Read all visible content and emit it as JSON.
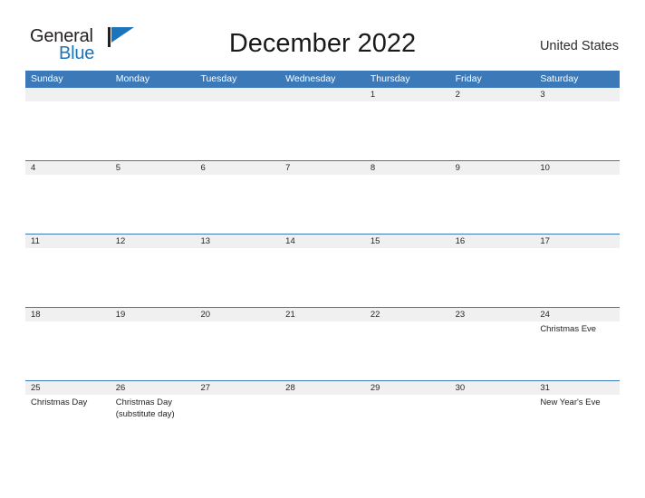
{
  "brand": {
    "name_part1": "General",
    "name_part2": "Blue",
    "flag_color": "#1b75bb"
  },
  "header": {
    "title": "December 2022",
    "region": "United States"
  },
  "calendar": {
    "accent_color": "#3b79b8",
    "date_band_color": "#f0f0f0",
    "weekday_headers": [
      "Sunday",
      "Monday",
      "Tuesday",
      "Wednesday",
      "Thursday",
      "Friday",
      "Saturday"
    ],
    "weeks": [
      {
        "dates": [
          "",
          "",
          "",
          "",
          "1",
          "2",
          "3"
        ],
        "events": [
          "",
          "",
          "",
          "",
          "",
          "",
          ""
        ]
      },
      {
        "dates": [
          "4",
          "5",
          "6",
          "7",
          "8",
          "9",
          "10"
        ],
        "events": [
          "",
          "",
          "",
          "",
          "",
          "",
          ""
        ]
      },
      {
        "dates": [
          "11",
          "12",
          "13",
          "14",
          "15",
          "16",
          "17"
        ],
        "events": [
          "",
          "",
          "",
          "",
          "",
          "",
          ""
        ]
      },
      {
        "dates": [
          "18",
          "19",
          "20",
          "21",
          "22",
          "23",
          "24"
        ],
        "events": [
          "",
          "",
          "",
          "",
          "",
          "",
          "Christmas Eve"
        ]
      },
      {
        "dates": [
          "25",
          "26",
          "27",
          "28",
          "29",
          "30",
          "31"
        ],
        "events": [
          "Christmas Day",
          "Christmas Day (substitute day)",
          "",
          "",
          "",
          "",
          "New Year's Eve"
        ]
      }
    ]
  }
}
